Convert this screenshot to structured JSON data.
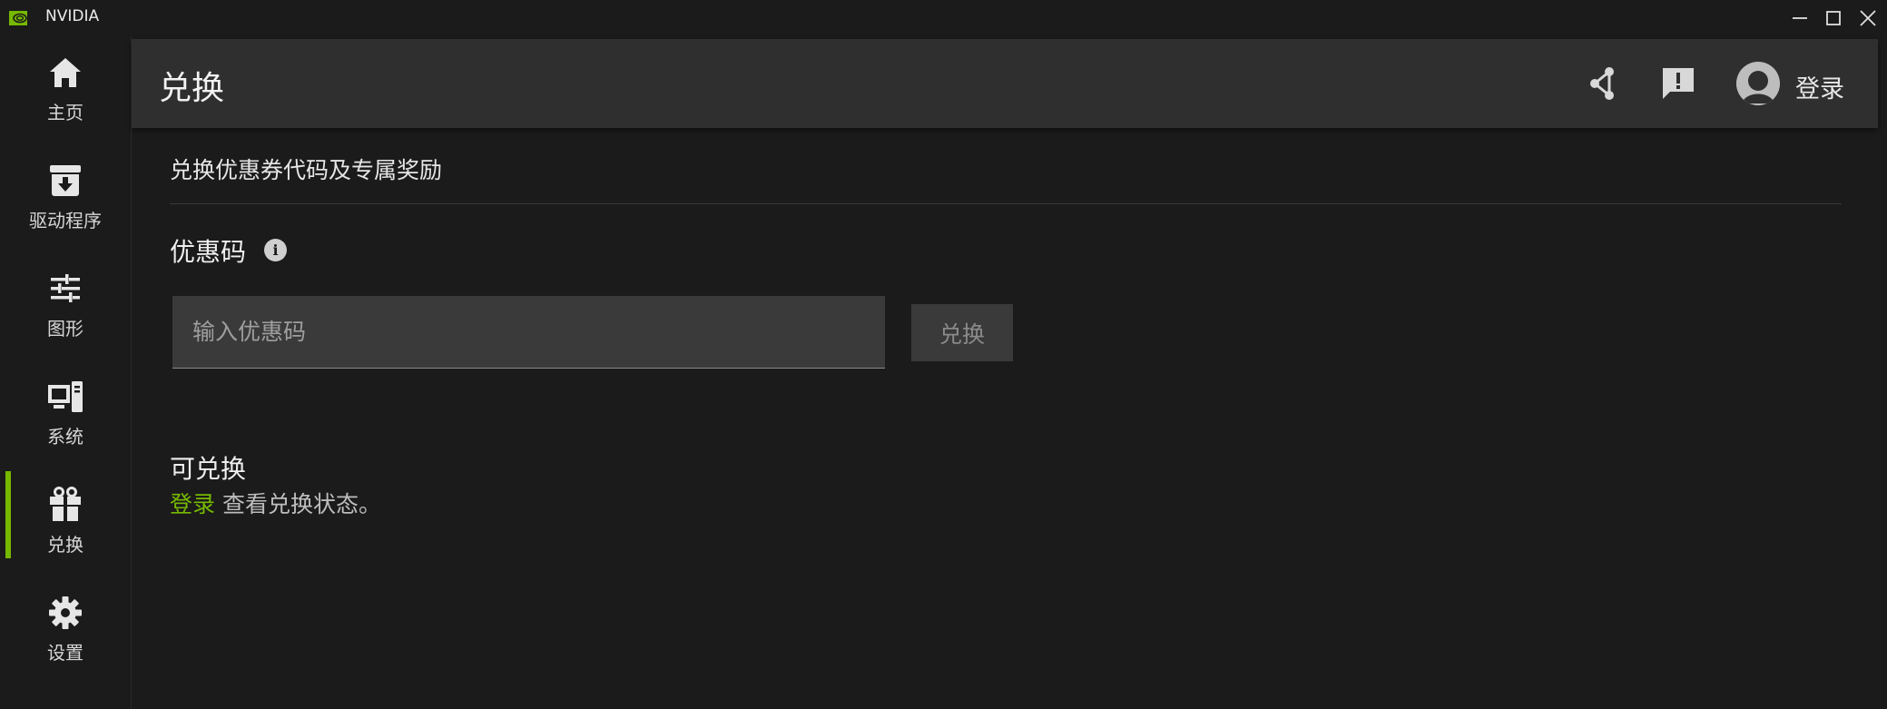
{
  "window": {
    "app_title": "NVIDIA",
    "brand_color": "#76b900",
    "controls": {
      "minimize_icon": "minimize-icon",
      "maximize_icon": "maximize-icon",
      "close_icon": "close-icon"
    }
  },
  "sidebar": {
    "active_index": 4,
    "items": [
      {
        "label": "主页",
        "icon": "home-icon"
      },
      {
        "label": "驱动程序",
        "icon": "download-box-icon"
      },
      {
        "label": "图形",
        "icon": "sliders-icon"
      },
      {
        "label": "系统",
        "icon": "monitor-tower-icon"
      },
      {
        "label": "兑换",
        "icon": "gift-icon"
      },
      {
        "label": "设置",
        "icon": "gear-icon"
      }
    ]
  },
  "header": {
    "title": "兑换",
    "share_icon": "share-icon",
    "feedback_icon": "feedback-icon",
    "avatar_icon": "user-avatar-icon",
    "login_label": "登录"
  },
  "content": {
    "section_title": "兑换优惠券代码及专属奖励",
    "promo_label": "优惠码",
    "info_icon": "info-icon",
    "promo_input": {
      "value": "",
      "placeholder": "输入优惠码"
    },
    "redeem_button": "兑换",
    "available_title": "可兑换",
    "status": {
      "login_link": "登录",
      "suffix": " 查看兑换状态。"
    }
  }
}
